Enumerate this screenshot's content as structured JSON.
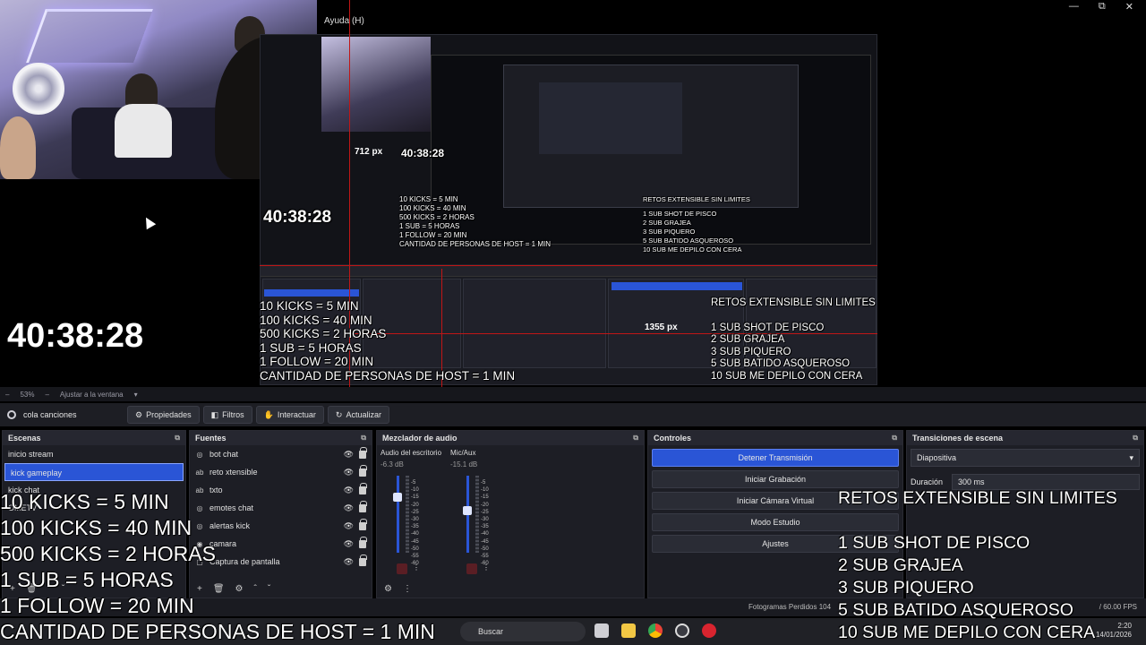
{
  "window": {
    "menu_help": "Ayuda (H)",
    "nested_menu_help": "Ayuda (H)"
  },
  "overlay": {
    "timer": "40:38:28",
    "px_label_1": "712 px",
    "px_label_2": "1355 px",
    "kick_rules": [
      "10 KICKS = 5 MIN",
      "100 KICKS = 40 MIN",
      "500 KICKS = 2 HORAS",
      "1 SUB = 5 HORAS",
      " 1 FOLLOW = 20 MIN",
      "CANTIDAD DE PERSONAS DE HOST = 1 MIN"
    ],
    "challenges_title": "RETOS EXTENSIBLE SIN LIMITES",
    "challenges": [
      "1 SUB SHOT DE PISCO",
      "2 SUB  GRAJEA",
      "3 SUB PIQUERO",
      "5 SUB BATIDO ASQUEROSO",
      "10 SUB ME DEPILO CON CERA"
    ]
  },
  "zoom": {
    "level": "53%",
    "fit_label": "Ajustar a la ventana"
  },
  "source_toolbar": {
    "source_name": "cola canciones",
    "properties": "Propiedades",
    "filters": "Filtros",
    "interact": "Interactuar",
    "refresh": "Actualizar"
  },
  "scenes": {
    "title": "Escenas",
    "items": [
      {
        "label": "inicio stream"
      },
      {
        "label": "kick gameplay"
      },
      {
        "label": "kick chat"
      },
      {
        "label": "OMETV"
      }
    ]
  },
  "sources": {
    "title": "Fuentes",
    "items": [
      {
        "label": "bot chat",
        "icon": "globe-icon"
      },
      {
        "label": "reto xtensible",
        "icon": "text-icon"
      },
      {
        "label": "txto",
        "icon": "text-icon"
      },
      {
        "label": "emotes chat",
        "icon": "globe-icon"
      },
      {
        "label": "alertas kick",
        "icon": "globe-icon"
      },
      {
        "label": "camara",
        "icon": "camera-icon"
      },
      {
        "label": "Captura de pantalla",
        "icon": "monitor-icon"
      }
    ]
  },
  "mixer": {
    "title": "Mezclador de audio",
    "channels": [
      {
        "name": "Audio del escritorio",
        "db": "-6.3 dB",
        "level": 0.78
      },
      {
        "name": "Mic/Aux",
        "db": "-15.1 dB",
        "level": 0.6
      }
    ],
    "scale": [
      "-5",
      "-10",
      "-15",
      "-20",
      "-25",
      "-30",
      "-35",
      "-40",
      "-45",
      "-50",
      "-55",
      "-60"
    ]
  },
  "controls": {
    "title": "Controles",
    "stop_stream": "Detener Transmisión",
    "start_recording": "Iniciar Grabación",
    "start_virtual_cam": "Iniciar Cámara Virtual",
    "studio_mode": "Modo Estudio",
    "settings": "Ajustes"
  },
  "transitions": {
    "title": "Transiciones de escena",
    "selected": "Diapositiva",
    "duration_label": "Duración",
    "duration_value": "300 ms"
  },
  "status": {
    "frames_dropped": "Fotogramas Perdidos 104",
    "fps": "/ 60.00 FPS"
  },
  "taskbar": {
    "search_placeholder": "Buscar",
    "time": "2:20",
    "date": "14/01/2026"
  },
  "colors": {
    "accent": "#2a55d6",
    "guide_red": "#c01616"
  }
}
